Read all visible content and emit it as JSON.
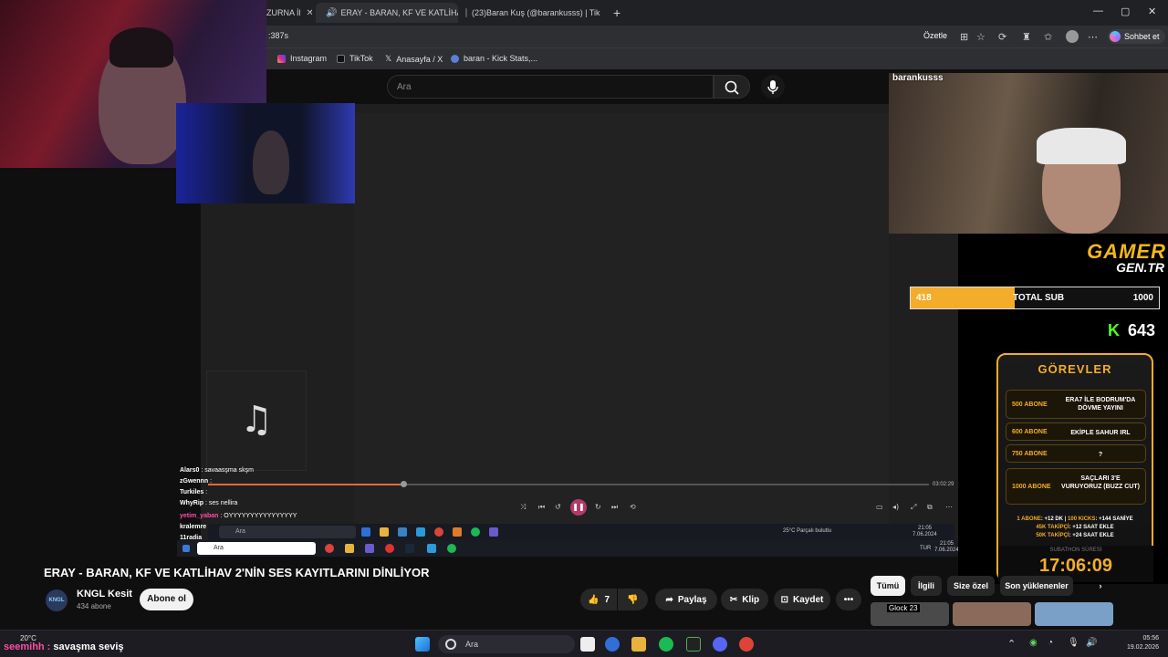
{
  "browser": {
    "tabs": [
      {
        "label": "ZURNA İl",
        "close": "✕"
      },
      {
        "label": "ERAY - BARAN, KF VE KATLİHA",
        "close": "✕"
      },
      {
        "label": "(23)Baran Kuş (@barankusss) | Tik",
        "close": "✕"
      }
    ],
    "new_tab": "+",
    "window": {
      "minimize": "—",
      "maximize": "▢",
      "close": "✕"
    },
    "address": ":387s",
    "ozetle": "Özetle",
    "sohbet": "Sohbet et",
    "bookmarks": [
      "Instagram",
      "TikTok",
      "Anasayfa / X",
      "baran - Kick Stats,..."
    ]
  },
  "youtube_search": {
    "placeholder": "Ara"
  },
  "stream": {
    "channel_tag": "barankusss",
    "chat": [
      {
        "user": "Alars0",
        "msg": ": savaasşma skşm",
        "color": "#ffffff"
      },
      {
        "user": "zGwennn",
        "msg": ":",
        "color": "#ffffff"
      },
      {
        "user": "Turkiles",
        "msg": ":",
        "color": "#ff6b6b"
      },
      {
        "user": "WhyRip",
        "msg": ": ses nellira",
        "color": "#ffffff"
      },
      {
        "user": "yetim_yaban",
        "msg": ": OYYYYYYYYYYYYYYYY",
        "color": "#ff4da6"
      },
      {
        "user": "kralemre",
        "msg": "",
        "color": "#ffffff"
      },
      {
        "user": "11radia",
        "msg": "",
        "color": "#ffffff"
      }
    ],
    "chat_overlay": "savaşma seviş",
    "player_time": "03:02:29",
    "inner_search": "Ara",
    "inner_weather": "25°C  Parçalı bulutlu",
    "inner_clock": "21:05",
    "inner_date": "7.06.2024",
    "inner_lang": "TUR",
    "inner_time2": "21:05",
    "inner_date2": "7.06.2024"
  },
  "overlay": {
    "logo": "GAMER",
    "logo_sub": "GEN.TR",
    "sub_current": "418",
    "sub_label": "TOTAL SUB",
    "sub_goal": "1000",
    "sub_progress": 0.418,
    "kick_icon": "K",
    "kick_count": "643",
    "gorevler_title": "GÖREVLER",
    "tasks": [
      {
        "label": "500 ABONE",
        "desc": "ERA7 İLE BODRUM'DA DÖVME YAYINI"
      },
      {
        "label": "600 ABONE",
        "desc": "EKİPLE SAHUR IRL"
      },
      {
        "label": "750 ABONE",
        "desc": "?"
      },
      {
        "label": "1000 ABONE",
        "desc": "SAÇLARI 3'E VURUYORUZ (BUZZ CUT)"
      }
    ],
    "rates": [
      [
        "1 ABONE",
        ": +12 DK",
        "100 KICKS",
        ": +144 SANİYE"
      ],
      [
        "45K TAKİPÇİ",
        ": +12 SAAT EKLE"
      ],
      [
        "50K TAKİPÇİ",
        ": +24 SAAT EKLE"
      ]
    ],
    "timer_label": "SUBATHON SÜRESİ",
    "timer": "17:06:09"
  },
  "video": {
    "title": "ERAY - BARAN, KF VE KATLİHAV 2'NİN SES KAYITLARINI DİNLİYOR",
    "channel": "KNGL Kesit",
    "channel_avatar": "KNGL",
    "subscribers": "434 abone",
    "subscribe_label": "Abone ol",
    "likes": "7",
    "share": "Paylaş",
    "clip": "Klip",
    "save": "Kaydet",
    "more": "•••"
  },
  "filters": [
    "Tümü",
    "İlgili",
    "Size özel",
    "Son yüklenenler"
  ],
  "thumbs": [
    {
      "label": "Glock 23"
    }
  ],
  "taskbar": {
    "weather_temp": "20°C",
    "search": "Ara",
    "time": "05:56",
    "date": "19.02.2026"
  },
  "colors": {
    "accent": "#f3ad2a",
    "kick": "#53fc18",
    "youtube_red": "#ff0000"
  }
}
